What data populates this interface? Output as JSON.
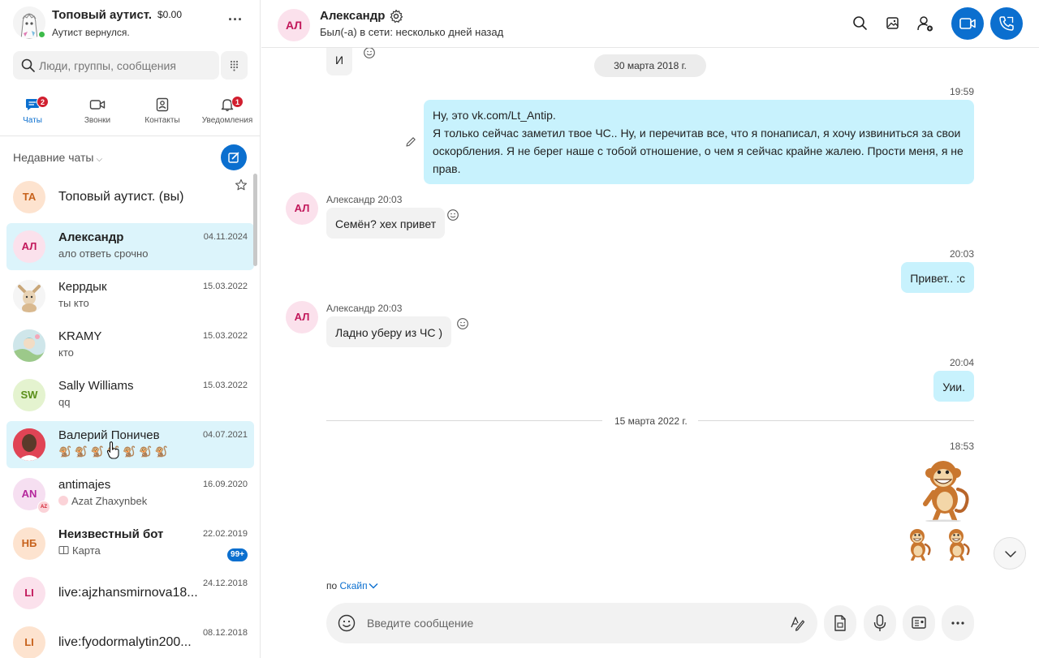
{
  "profile": {
    "name": "Топовый аутист.",
    "balance": "$0.00",
    "status": "Аутист вернулся.",
    "more_label": "···"
  },
  "search": {
    "placeholder": "Люди, группы, сообщения"
  },
  "tabs": [
    {
      "label": "Чаты",
      "badge": "2",
      "icon": "chat-icon",
      "active": true
    },
    {
      "label": "Звонки",
      "icon": "video-camera-icon"
    },
    {
      "label": "Контакты",
      "icon": "contacts-icon"
    },
    {
      "label": "Уведомления",
      "badge": "1",
      "icon": "bell-icon"
    }
  ],
  "recent": {
    "header": "Недавние чаты",
    "chevron": "⌵"
  },
  "chats": [
    {
      "initials": "ТА",
      "name": "Топовый аутист. (вы)"
    },
    {
      "initials": "АЛ",
      "name": "Александр",
      "date": "04.11.2024",
      "preview": "ало ответь срочно"
    },
    {
      "name": "Керрдык",
      "date": "15.03.2022",
      "preview": "ты кто"
    },
    {
      "name": "KRAMY",
      "date": "15.03.2022",
      "preview": "кто"
    },
    {
      "initials": "SW",
      "name": "Sally Williams",
      "date": "15.03.2022",
      "preview": "qq"
    },
    {
      "name": "Валерий Поничев",
      "date": "04.07.2021",
      "preview": "🐒 🐒 🐒 🐒 🐒 🐒 🐒"
    },
    {
      "initials": "AN",
      "sub_initials": "AZ",
      "name": "antimajes",
      "date": "16.09.2020",
      "preview": "Azat Zhaxynbek"
    },
    {
      "initials": "НБ",
      "name": "Неизвестный бот",
      "date": "22.02.2019",
      "preview": "Карта",
      "badge": "99+"
    },
    {
      "initials": "LI",
      "name": "live:ajzhansmirnova18...",
      "date": "24.12.2018"
    },
    {
      "initials": "LI",
      "name": "live:fyodormalytin200...",
      "date": "08.12.2018"
    }
  ],
  "conversation": {
    "header": {
      "initials": "АЛ",
      "name": "Александр",
      "status": "Был(-а) в сети: несколько дней назад"
    },
    "messages": {
      "top_partial": "И",
      "date_1": "30 марта 2018 г.",
      "out_1_time": "19:59",
      "out_1_line1": "Ну, это vk.com/Lt_Antip.",
      "out_1_line2": "Я только сейчас заметил твое ЧС.. Ну, и перечитав все, что я понаписал, я хочу извиниться за свои оскорбления. Я не берег наше с тобой отношение, о чем я сейчас крайне жалею. Прости меня, я не прав.",
      "in_1_meta": "Александр 20:03",
      "in_1_text": "Семён? хех привет",
      "out_2_time": "20:03",
      "out_2_text": "Привет.. :c",
      "in_2_meta": "Александр 20:03",
      "in_2_text": "Ладно уберу из ЧС )",
      "out_3_time": "20:04",
      "out_3_text": "Уии.",
      "date_2": "15 марта 2022 г.",
      "sticker_time": "18:53"
    },
    "via_prefix": "по",
    "via_link": "Скайп",
    "composer_placeholder": "Введите сообщение"
  },
  "colors": {
    "accent": "#0b6fcf",
    "outgoing_bubble": "#c8f2fd",
    "incoming_bubble": "#f2f2f2",
    "selected_chat": "#dcf4fb",
    "badge_red": "#d11f2f",
    "online_green": "#3dbb4a"
  }
}
